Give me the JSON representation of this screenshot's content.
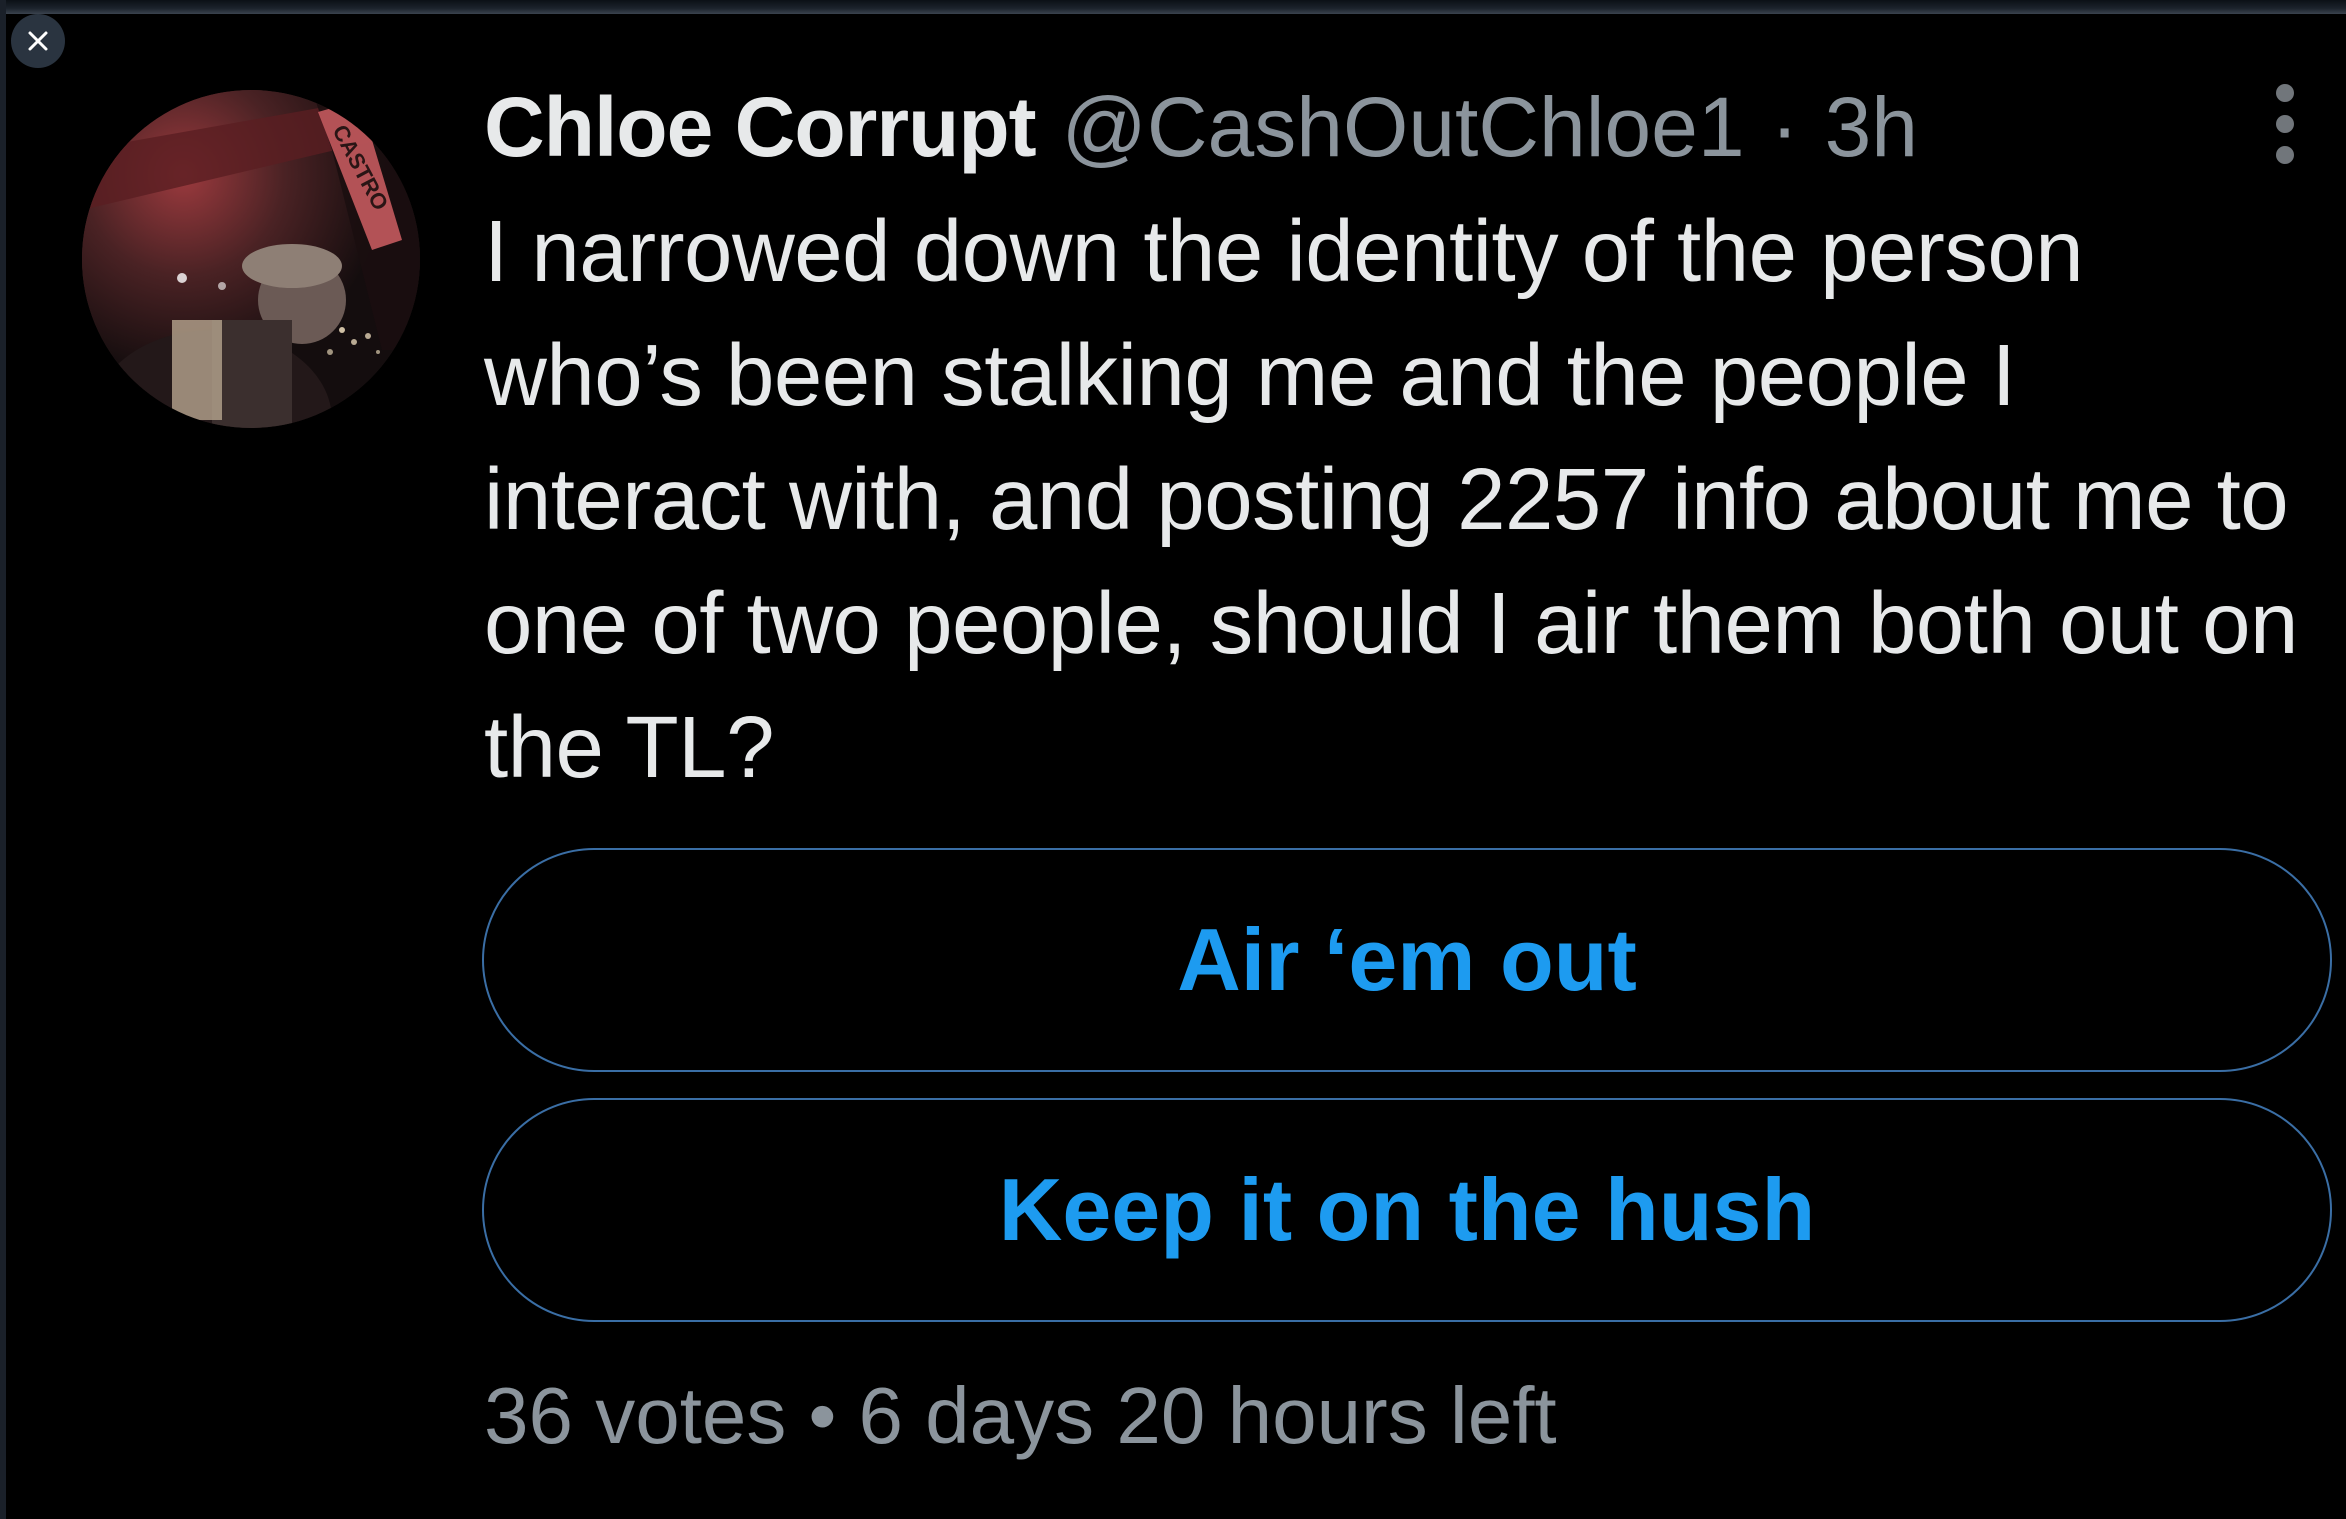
{
  "viewer": {
    "close_icon": "close-icon"
  },
  "tweet": {
    "author": {
      "display_name": "Chloe Corrupt",
      "handle": "@CashOutChloe1",
      "separator": "·",
      "time": "3h",
      "avatar_sign_text": "CASTRO"
    },
    "text": "I narrowed down the identity of the person who’s been stalking me and the people I interact with, and posting 2257 info about me to one of two people, should I air them both out on the TL?",
    "poll": {
      "options": [
        {
          "label": "Air ‘em out"
        },
        {
          "label": "Keep it on the hush"
        }
      ],
      "votes": "36 votes",
      "dot": "•",
      "time_left": "6 days 20 hours left"
    },
    "more_icon": "more-vertical-icon"
  },
  "colors": {
    "background": "#000000",
    "primary_text": "#e7e9ea",
    "secondary_text": "#8b949c",
    "accent": "#1d9bf0",
    "poll_border": "#3a6ea5"
  }
}
